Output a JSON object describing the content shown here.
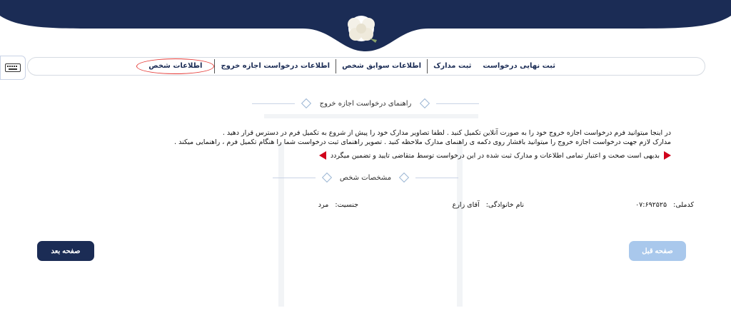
{
  "tabs": [
    {
      "label": "اطلاعات شخص",
      "active": true
    },
    {
      "label": "اطلاعات درخواست اجازه خروج",
      "active": false
    },
    {
      "label": "اطلاعات سوابق شخص",
      "active": false
    },
    {
      "label": "ثبت مدارک",
      "active": false
    },
    {
      "label": "ثبت نهایی درخواست",
      "active": false
    }
  ],
  "guide": {
    "title": "راهنمای درخواست اجازه خروج",
    "line1": "در اینجا میتوانید فرم درخواست اجازه خروج خود را به صورت آنلاین تکمیل کنید . لطفا تصاویر مدارک خود را پیش از شروع به تکمیل فرم در دسترس قرار دهید .",
    "line2": "مدارک لازم جهت درخواست اجازه خروج را میتوانید بافشار روی دکمه ی راهنمای مدارک ملاحظه کنید . تصویر راهنمای ثبت درخواست شما را هنگام تکمیل فرم ، راهنمایی میکند .",
    "warning": "بدیهی است صحت و اعتبار تمامی اطلاعات و مدارک ثبت شده در این درخواست توسط متقاضی تایید و تضمین میگردد"
  },
  "person": {
    "title": "مشخصات شخص",
    "national_code_label": "کدملی:",
    "national_code_value": "۰۷:۶۹۲۵۲۵",
    "family_label": "نام خانوادگی:",
    "family_value": "آقای زارع",
    "gender_label": "جنسیت:",
    "gender_value": "مرد"
  },
  "buttons": {
    "next": "صفحه بعد",
    "prev": "صفحه قبل"
  },
  "colors": {
    "navy": "#1b2c55",
    "light_blue": "#a9c8ec",
    "red": "#d0021b",
    "highlight": "#e53935"
  }
}
